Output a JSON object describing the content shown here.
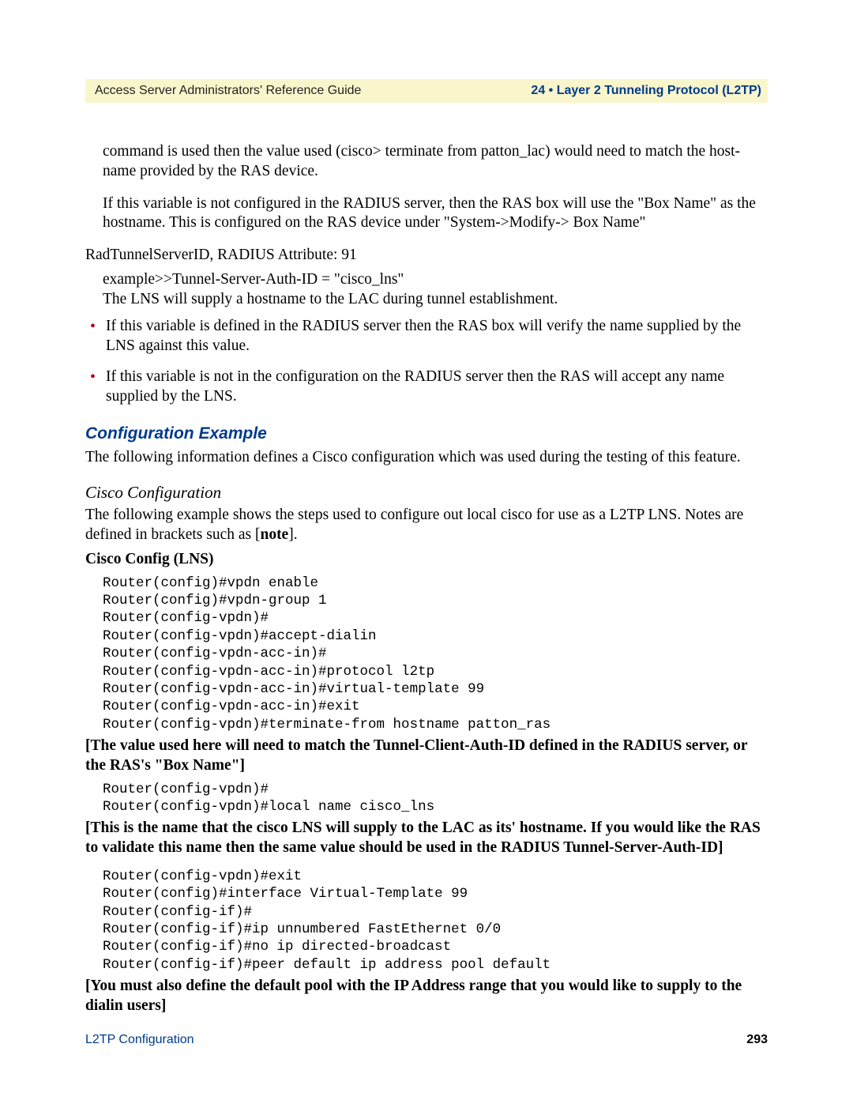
{
  "header": {
    "left": "Access Server Administrators' Reference Guide",
    "right": "24 • Layer 2 Tunneling Protocol (L2TP)"
  },
  "paras": {
    "p1": "command is used then the value used (cisco> terminate from patton_lac) would need to match the host-name provided by the RAS device.",
    "p2": "If this variable is not configured in the RADIUS server, then the RAS box will use the \"Box Name\" as the hostname. This is configured on the RAS device under \"System->Modify-> Box Name\"",
    "attr": "RadTunnelServerID, RADIUS Attribute: 91",
    "ex1": "example>>Tunnel-Server-Auth-ID = \"cisco_lns\"",
    "ex2": "The LNS will supply a hostname to the LAC during tunnel establishment.",
    "b1": "If this variable is defined in the RADIUS server then the RAS box will verify the name supplied by the LNS against this value.",
    "b2": "If this variable is not in the configuration on the RADIUS server then the RAS will accept any name supplied by the LNS."
  },
  "config": {
    "h1": "Configuration Example",
    "intro": "The following information defines a Cisco configuration which was used during the testing of this feature.",
    "h2": "Cisco Configuration",
    "intro2a": "The following example shows the steps used to configure out local cisco for use as a L2TP LNS. Notes are defined in brackets such as [",
    "intro2b": "note",
    "intro2c": "].",
    "lns_label": "Cisco Config (LNS)",
    "code1": "Router(config)#vpdn enable\nRouter(config)#vpdn-group 1\nRouter(config-vpdn)#\nRouter(config-vpdn)#accept-dialin\nRouter(config-vpdn-acc-in)#\nRouter(config-vpdn-acc-in)#protocol l2tp\nRouter(config-vpdn-acc-in)#virtual-template 99\nRouter(config-vpdn-acc-in)#exit\nRouter(config-vpdn)#terminate-from hostname patton_ras",
    "note1": "[The value used here will need to match the Tunnel-Client-Auth-ID defined in the RADIUS server, or the RAS's \"Box Name\"]",
    "code2": "Router(config-vpdn)#\nRouter(config-vpdn)#local name cisco_lns",
    "note2": "[This is the name that the cisco LNS will supply to the LAC as its' hostname. If you would like the RAS to validate this name then the same value should be used in the RADIUS Tunnel-Server-Auth-ID]",
    "code3": "Router(config-vpdn)#exit\nRouter(config)#interface Virtual-Template 99\nRouter(config-if)#\nRouter(config-if)#ip unnumbered FastEthernet 0/0\nRouter(config-if)#no ip directed-broadcast\nRouter(config-if)#peer default ip address pool default",
    "note3": "[You must also define the default pool with the IP Address range that you would like to supply to the dialin users]"
  },
  "footer": {
    "left": "L2TP Configuration",
    "page": "293"
  }
}
